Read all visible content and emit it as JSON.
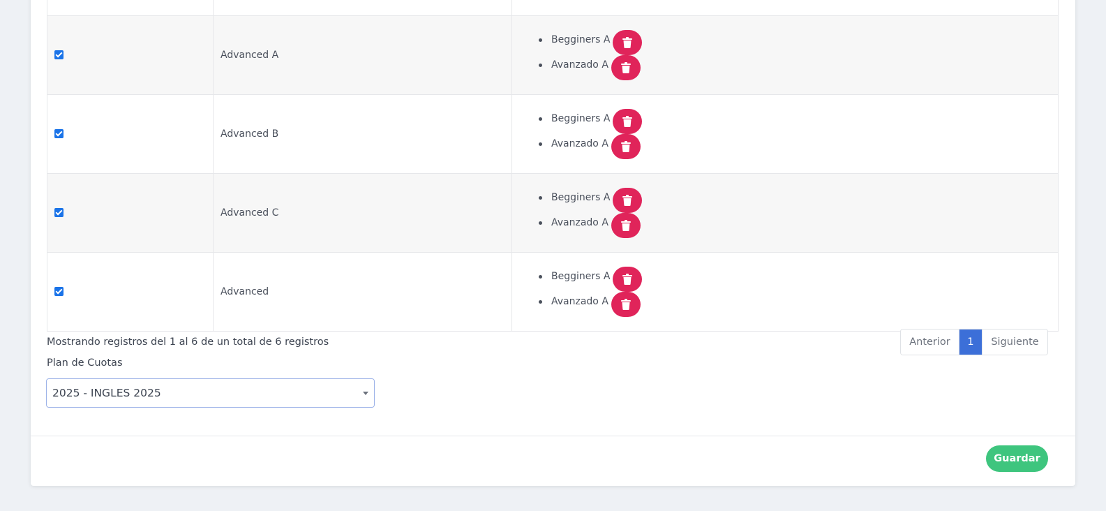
{
  "table": {
    "rows": [
      {
        "checked": true,
        "name": "Advanced A",
        "groups": [
          "Begginers A",
          "Avanzado A"
        ]
      },
      {
        "checked": true,
        "name": "Advanced B",
        "groups": [
          "Begginers A",
          "Avanzado A"
        ]
      },
      {
        "checked": true,
        "name": "Advanced C",
        "groups": [
          "Begginers A",
          "Avanzado A"
        ]
      },
      {
        "checked": true,
        "name": "Advanced",
        "groups": [
          "Begginers A",
          "Avanzado A"
        ]
      }
    ]
  },
  "footer": {
    "info": "Mostrando registros del 1 al 6 de un total de 6 registros"
  },
  "pagination": {
    "prev": "Anterior",
    "current": "1",
    "next": "Siguiente"
  },
  "plan": {
    "label": "Plan de Cuotas",
    "selected": "2025 - INGLES 2025"
  },
  "actions": {
    "save_label": "Guardar"
  },
  "icons": {
    "delete": "trash-icon",
    "dropdown": "caret-down-icon",
    "checkbox": "check-icon"
  },
  "colors": {
    "danger": "#e0245a",
    "primary": "#3c6fd8",
    "success": "#3ec57e",
    "checkbox": "#1a73e8"
  }
}
